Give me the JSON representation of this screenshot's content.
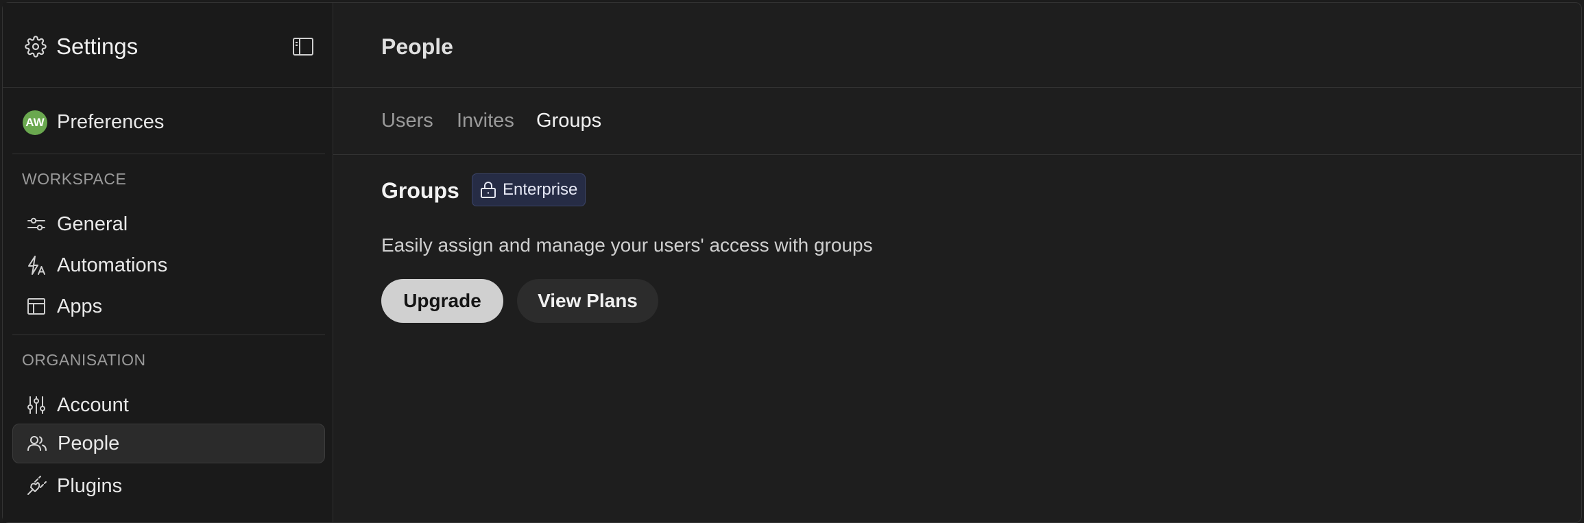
{
  "sidebar": {
    "title": "Settings",
    "title_icon": "gear-icon",
    "toggle_icon": "sidebar-toggle-icon",
    "preferences": {
      "avatar_initials": "AW",
      "label": "Preferences"
    },
    "workspace": {
      "heading": "WORKSPACE",
      "items": [
        {
          "label": "General",
          "icon": "sliders-horizontal-icon"
        },
        {
          "label": "Automations",
          "icon": "automation-bolt-icon"
        },
        {
          "label": "Apps",
          "icon": "apps-layout-icon"
        }
      ]
    },
    "organisation": {
      "heading": "ORGANISATION",
      "items": [
        {
          "label": "Account",
          "icon": "sliders-vertical-icon"
        },
        {
          "label": "People",
          "icon": "people-icon",
          "active": true
        },
        {
          "label": "Plugins",
          "icon": "plug-icon"
        }
      ]
    }
  },
  "main": {
    "title": "People",
    "tabs": [
      {
        "label": "Users"
      },
      {
        "label": "Invites"
      },
      {
        "label": "Groups",
        "active": true
      }
    ],
    "section": {
      "title": "Groups",
      "badge": {
        "label": "Enterprise",
        "icon": "lock-icon"
      },
      "description": "Easily assign and manage your users' access with groups",
      "buttons": {
        "upgrade": "Upgrade",
        "view_plans": "View Plans"
      }
    }
  },
  "colors": {
    "avatar": "#6aa84f",
    "badge_bg": "#262c45",
    "primary_button": "#d0d0d0"
  }
}
